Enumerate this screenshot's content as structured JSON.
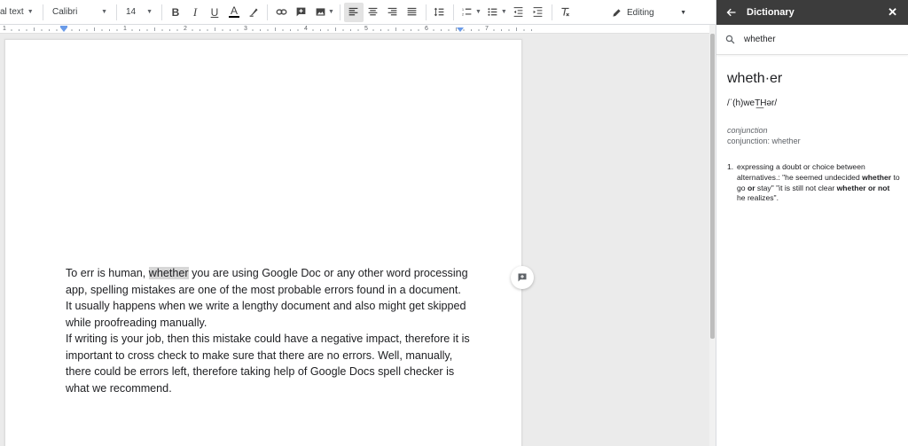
{
  "toolbar": {
    "style_label": "al text",
    "font_label": "Calibri",
    "size_label": "14",
    "bold": "B",
    "italic": "I",
    "underline": "U",
    "text_color": "A",
    "mode_label": "Editing"
  },
  "ruler": {
    "numbers": [
      "1",
      "1",
      "2",
      "3",
      "4",
      "5",
      "6",
      "7"
    ]
  },
  "document": {
    "before": "To err is human, ",
    "highlight": "whether",
    "line1_rest": " you are using Google Doc or any other word processing",
    "line2": "app, spelling mistakes are one of the most probable errors found in a document.",
    "line3": "It usually happens when we write a lengthy document and also might get skipped",
    "line4": "while proofreading manually.",
    "line5": "If writing is your job, then this mistake could have a negative impact, therefore it is",
    "line6": "important to cross check to make sure that there are no errors.  Well, manually,",
    "line7": "there could be errors left, therefore taking help of Google Docs spell checker is",
    "line8": "what we recommend."
  },
  "dictionary": {
    "title": "Dictionary",
    "search_value": "whether",
    "headword": "wheth·er",
    "pronunciation": "/ˈ(h)weT͟Hər/",
    "part_of_speech": "conjunction",
    "pos_prefix": "conjunction: ",
    "pos_word": "whether",
    "definition": {
      "number": "1.",
      "text": "expressing a doubt or choice between alternatives.: \"he seemed undecided ",
      "ex1_bold": "whether",
      "ex1_mid": " to go ",
      "ex1_or": "or",
      "ex1_end": " stay\" \"it is still not clear ",
      "ex2_bold": "whether or not",
      "ex2_end": " he realizes\"."
    }
  },
  "icons": [
    "chevron-down-icon",
    "highlighter-icon",
    "link-icon",
    "add-comment-icon",
    "image-icon",
    "align-left-icon",
    "align-center-icon",
    "align-right-icon",
    "justify-icon",
    "line-spacing-icon",
    "numbered-list-icon",
    "bulleted-list-icon",
    "decrease-indent-icon",
    "increase-indent-icon",
    "clear-formatting-icon",
    "pencil-icon",
    "back-arrow-icon",
    "close-icon",
    "search-icon"
  ],
  "colors": {
    "panel_header": "#3c3c3c",
    "page": "#ffffff",
    "canvas": "#ebebeb",
    "highlight": "#d7d7d7"
  }
}
